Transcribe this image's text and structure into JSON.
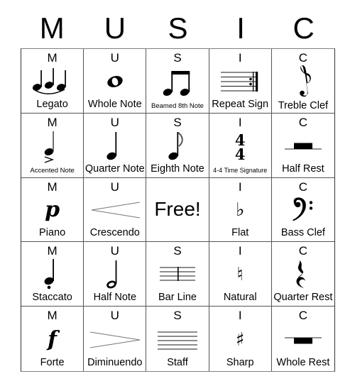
{
  "card": {
    "title_letters": [
      "M",
      "U",
      "S",
      "I",
      "C"
    ],
    "free_space_label": "Free!",
    "grid_size": "5x5",
    "ink_color": "#000000",
    "border_color": "#555555",
    "background_color": "#ffffff"
  },
  "cells": [
    {
      "letter": "M",
      "label": "Legato",
      "icon": "legato-slurred-notes-icon",
      "label_size": "normal"
    },
    {
      "letter": "U",
      "label": "Whole Note",
      "icon": "whole-note-icon",
      "label_size": "normal"
    },
    {
      "letter": "S",
      "label": "Beamed 8th Note",
      "icon": "beamed-eighth-notes-icon",
      "label_size": "small"
    },
    {
      "letter": "I",
      "label": "Repeat Sign",
      "icon": "repeat-sign-icon",
      "label_size": "normal"
    },
    {
      "letter": "C",
      "label": "Treble Clef",
      "icon": "treble-clef-icon",
      "label_size": "normal"
    },
    {
      "letter": "M",
      "label": "Accented Note",
      "icon": "accented-note-icon",
      "label_size": "small"
    },
    {
      "letter": "U",
      "label": "Quarter Note",
      "icon": "quarter-note-icon",
      "label_size": "normal"
    },
    {
      "letter": "S",
      "label": "Eighth Note",
      "icon": "eighth-note-icon",
      "label_size": "normal"
    },
    {
      "letter": "I",
      "label": "4-4 Time Signature",
      "icon": "time-signature-icon",
      "label_size": "tiny",
      "time_signature": {
        "top": "4",
        "bottom": "4"
      }
    },
    {
      "letter": "C",
      "label": "Half Rest",
      "icon": "half-rest-icon",
      "label_size": "normal"
    },
    {
      "letter": "M",
      "label": "Piano",
      "icon": "dynamic-piano-icon",
      "label_size": "normal",
      "glyph": "p"
    },
    {
      "letter": "U",
      "label": "Crescendo",
      "icon": "crescendo-hairpin-icon",
      "label_size": "normal"
    },
    {
      "letter": "",
      "label": "Free!",
      "icon": "free-space",
      "label_size": "free"
    },
    {
      "letter": "I",
      "label": "Flat",
      "icon": "flat-sign-icon",
      "label_size": "normal",
      "glyph": "♭"
    },
    {
      "letter": "C",
      "label": "Bass Clef",
      "icon": "bass-clef-icon",
      "label_size": "normal",
      "glyph": "𝄢"
    },
    {
      "letter": "M",
      "label": "Staccato",
      "icon": "staccato-note-icon",
      "label_size": "normal"
    },
    {
      "letter": "U",
      "label": "Half Note",
      "icon": "half-note-icon",
      "label_size": "normal"
    },
    {
      "letter": "S",
      "label": "Bar Line",
      "icon": "bar-line-icon",
      "label_size": "normal"
    },
    {
      "letter": "I",
      "label": "Natural",
      "icon": "natural-sign-icon",
      "label_size": "normal",
      "glyph": "♮"
    },
    {
      "letter": "C",
      "label": "Quarter Rest",
      "icon": "quarter-rest-icon",
      "label_size": "normal",
      "glyph": "𝄽"
    },
    {
      "letter": "M",
      "label": "Forte",
      "icon": "dynamic-forte-icon",
      "label_size": "normal",
      "glyph": "f"
    },
    {
      "letter": "U",
      "label": "Diminuendo",
      "icon": "diminuendo-hairpin-icon",
      "label_size": "normal"
    },
    {
      "letter": "S",
      "label": "Staff",
      "icon": "staff-icon",
      "label_size": "normal"
    },
    {
      "letter": "I",
      "label": "Sharp",
      "icon": "sharp-sign-icon",
      "label_size": "normal",
      "glyph": "♯"
    },
    {
      "letter": "C",
      "label": "Whole Rest",
      "icon": "whole-rest-icon",
      "label_size": "normal"
    }
  ]
}
